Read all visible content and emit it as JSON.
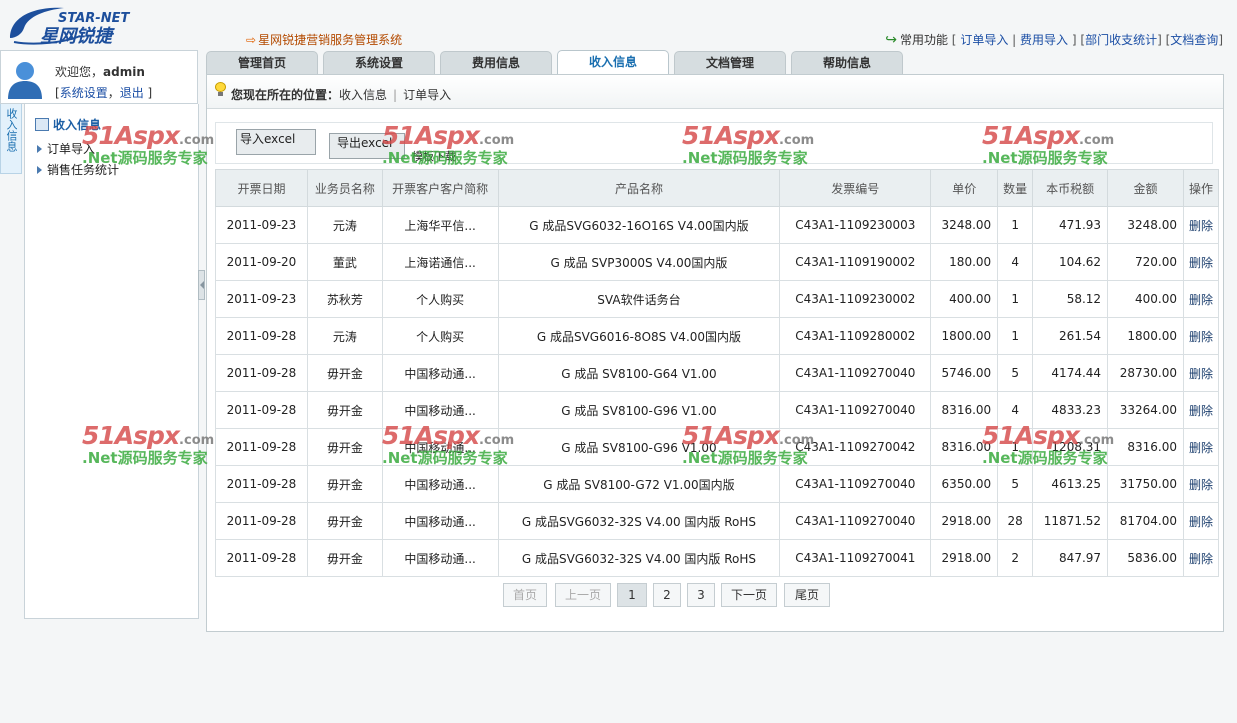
{
  "header": {
    "logo_text_top": "STAR-NET",
    "logo_text_bottom": "星网锐捷",
    "system_title": "星网锐捷营销服务管理系统",
    "quick_label": "常用功能",
    "quick_links": [
      "订单导入",
      "费用导入",
      "部门收支统计",
      "文档查询"
    ]
  },
  "user": {
    "welcome_prefix": "欢迎您，",
    "username": "admin",
    "settings_link": "系统设置",
    "logout_link": "退出"
  },
  "sidebar": {
    "vertical_tab": "收入信息",
    "title": "收入信息",
    "items": [
      {
        "label": "订单导入"
      },
      {
        "label": "销售任务统计"
      }
    ]
  },
  "tabs": [
    {
      "label": "管理首页",
      "active": false
    },
    {
      "label": "系统设置",
      "active": false
    },
    {
      "label": "费用信息",
      "active": false
    },
    {
      "label": "收入信息",
      "active": true
    },
    {
      "label": "文档管理",
      "active": false
    },
    {
      "label": "帮助信息",
      "active": false
    }
  ],
  "location": {
    "prefix": "您现在所在的位置：",
    "path": [
      "收入信息",
      "订单导入"
    ]
  },
  "toolbar": {
    "import_label": "导入excel",
    "export_label": "导出excel",
    "template_label": "模板下载"
  },
  "table": {
    "columns": [
      "开票日期",
      "业务员名称",
      "开票客户客户简称",
      "产品名称",
      "发票编号",
      "单价",
      "数量",
      "本币税额",
      "金额",
      "操作"
    ],
    "rows": [
      [
        "2011-09-23",
        "元涛",
        "上海华平信...",
        "G 成品SVG6032-16O16S V4.00国内版",
        "C43A1-1109230003",
        "3248.00",
        "1",
        "471.93",
        "3248.00",
        "删除"
      ],
      [
        "2011-09-20",
        "董武",
        "上海诺通信...",
        "G 成品  SVP3000S V4.00国内版",
        "C43A1-1109190002",
        "180.00",
        "4",
        "104.62",
        "720.00",
        "删除"
      ],
      [
        "2011-09-23",
        "苏秋芳",
        "个人购买",
        "SVA软件话务台",
        "C43A1-1109230002",
        "400.00",
        "1",
        "58.12",
        "400.00",
        "删除"
      ],
      [
        "2011-09-28",
        "元涛",
        "个人购买",
        "G 成品SVG6016-8O8S V4.00国内版",
        "C43A1-1109280002",
        "1800.00",
        "1",
        "261.54",
        "1800.00",
        "删除"
      ],
      [
        "2011-09-28",
        "毋开金",
        "中国移动通...",
        "G 成品  SV8100-G64 V1.00",
        "C43A1-1109270040",
        "5746.00",
        "5",
        "4174.44",
        "28730.00",
        "删除"
      ],
      [
        "2011-09-28",
        "毋开金",
        "中国移动通...",
        "G 成品  SV8100-G96 V1.00",
        "C43A1-1109270040",
        "8316.00",
        "4",
        "4833.23",
        "33264.00",
        "删除"
      ],
      [
        "2011-09-28",
        "毋开金",
        "中国移动通...",
        "G 成品  SV8100-G96 V1.00",
        "C43A1-1109270042",
        "8316.00",
        "1",
        "1208.31",
        "8316.00",
        "删除"
      ],
      [
        "2011-09-28",
        "毋开金",
        "中国移动通...",
        "G 成品  SV8100-G72 V1.00国内版",
        "C43A1-1109270040",
        "6350.00",
        "5",
        "4613.25",
        "31750.00",
        "删除"
      ],
      [
        "2011-09-28",
        "毋开金",
        "中国移动通...",
        "G 成品SVG6032-32S V4.00 国内版  RoHS",
        "C43A1-1109270040",
        "2918.00",
        "28",
        "11871.52",
        "81704.00",
        "删除"
      ],
      [
        "2011-09-28",
        "毋开金",
        "中国移动通...",
        "G 成品SVG6032-32S V4.00 国内版  RoHS",
        "C43A1-1109270041",
        "2918.00",
        "2",
        "847.97",
        "5836.00",
        "删除"
      ]
    ]
  },
  "pager": {
    "first": "首页",
    "prev": "上一页",
    "pages": [
      "1",
      "2",
      "3"
    ],
    "current": "1",
    "next": "下一页",
    "last": "尾页"
  },
  "watermark": {
    "brand": "51Aspx",
    "domain": ".com",
    "slogan": ".Net源码服务专家"
  }
}
